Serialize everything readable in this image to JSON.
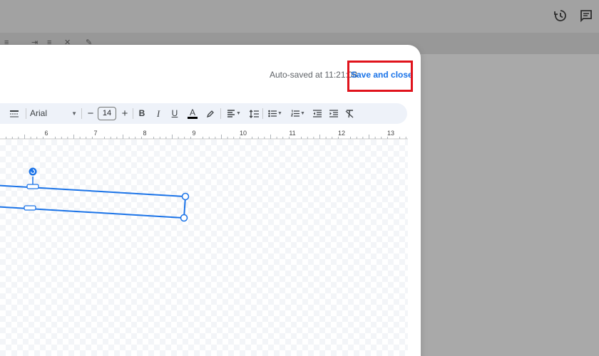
{
  "background": {
    "icons": [
      "history-icon",
      "comment-icon"
    ]
  },
  "dialog": {
    "autosave_text": "Auto-saved at 11:21:08",
    "save_close_label": "Save and close"
  },
  "toolbar": {
    "font": "Arial",
    "font_size": "14",
    "bold": "B",
    "italic": "I",
    "underline": "U",
    "text_color": "A"
  },
  "ruler": {
    "labels": [
      "6",
      "7",
      "8",
      "9",
      "10",
      "11",
      "12",
      "13"
    ]
  },
  "colors": {
    "accent": "#1a73e8",
    "highlight": "#e0131c",
    "toolbar_bg": "#eef2f9"
  }
}
